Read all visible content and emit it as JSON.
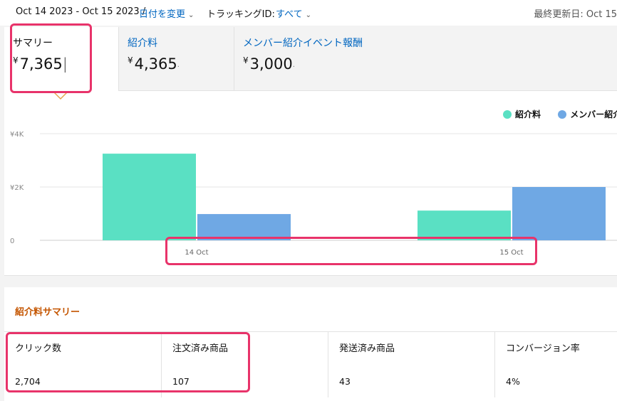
{
  "header": {
    "date_range": "Oct 14 2023 - Oct 15 2023 /",
    "change_date": "日付を変更",
    "tracking_label": "トラッキングID:",
    "tracking_value": "すべて",
    "last_updated": "最終更新日: Oct 15"
  },
  "tabs": [
    {
      "label": "サマリー",
      "currency": "¥",
      "amount": "7,365"
    },
    {
      "label": "紹介料",
      "currency": "¥",
      "amount": "4,365"
    },
    {
      "label": "メンバー紹介イベント報酬",
      "currency": "¥",
      "amount": "3,000"
    }
  ],
  "chart_data": {
    "type": "bar",
    "categories": [
      "14 Oct",
      "15 Oct"
    ],
    "series": [
      {
        "name": "紹介料",
        "color": "#5ae0c3",
        "values": [
          3250,
          1115
        ]
      },
      {
        "name": "メンバー紹介",
        "color": "#6fa8e4",
        "values": [
          985,
          2000
        ]
      }
    ],
    "y_ticks": [
      {
        "value": 0,
        "label": "0"
      },
      {
        "value": 2000,
        "label": "¥2K"
      },
      {
        "value": 4000,
        "label": "¥4K"
      }
    ],
    "ylim": [
      0,
      4000
    ],
    "grid": true,
    "legend_position": "top-right"
  },
  "summary": {
    "title": "紹介料サマリー",
    "metrics": [
      {
        "label": "クリック数",
        "value": "2,704"
      },
      {
        "label": "注文済み商品",
        "value": "107"
      },
      {
        "label": "発送済み商品",
        "value": "43"
      },
      {
        "label": "コンバージョン率",
        "value": "4%"
      }
    ]
  },
  "colors": {
    "link": "#0066c0",
    "accent": "#c45500",
    "highlight": "#e8336a"
  }
}
